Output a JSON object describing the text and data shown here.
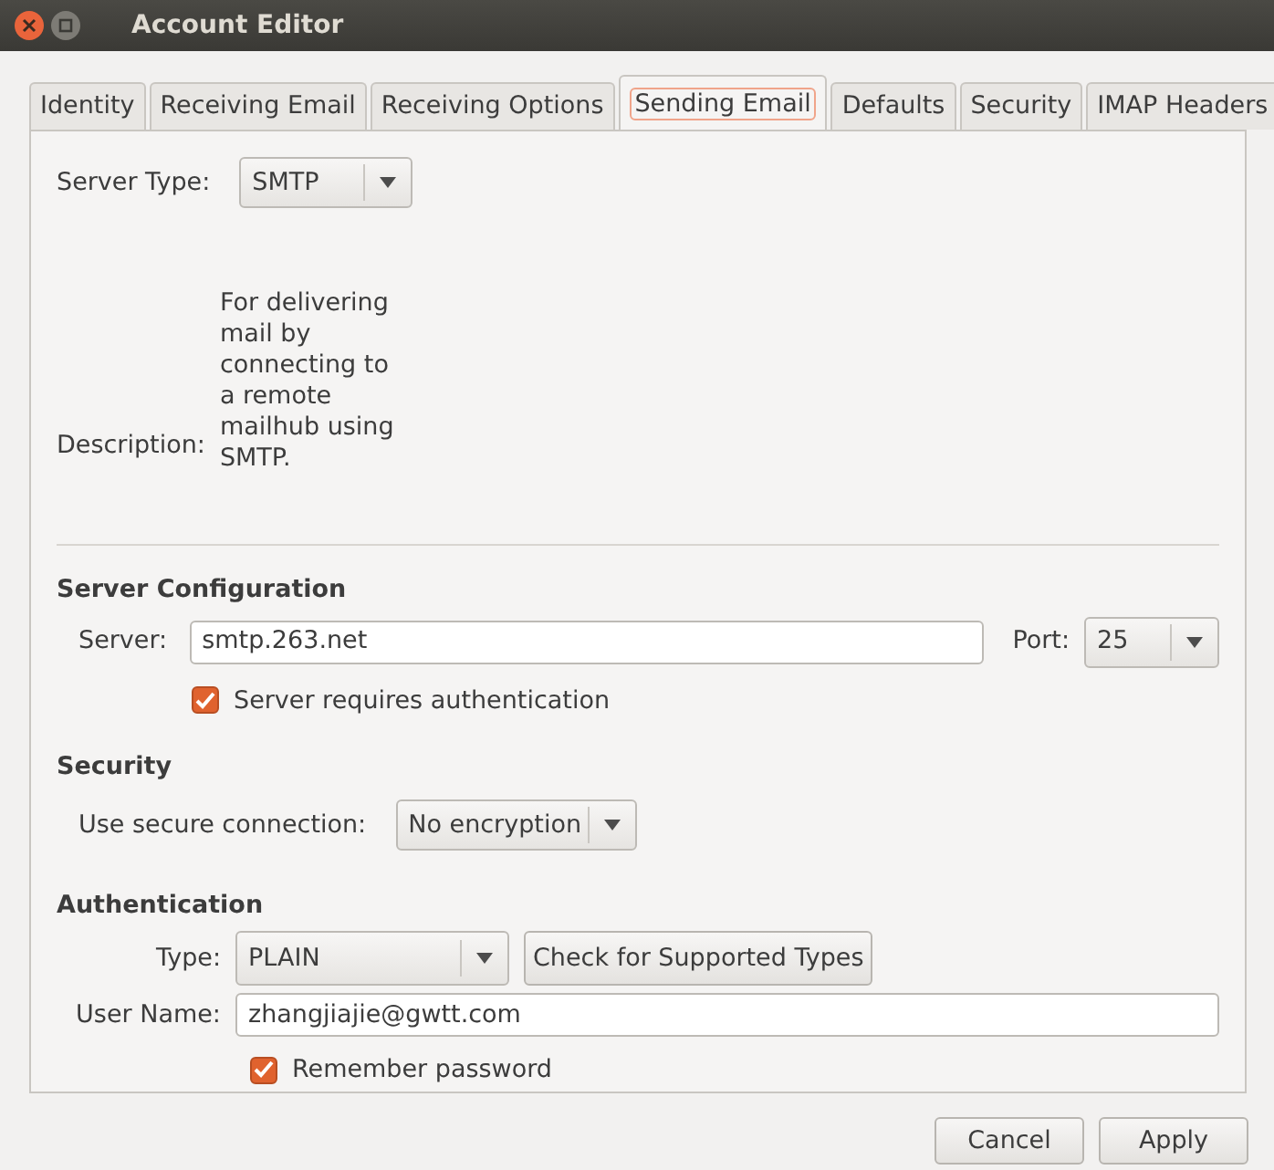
{
  "window": {
    "title": "Account Editor"
  },
  "tabs": [
    {
      "label": "Identity",
      "selected": false
    },
    {
      "label": "Receiving Email",
      "selected": false
    },
    {
      "label": "Receiving Options",
      "selected": false
    },
    {
      "label": "Sending Email",
      "selected": true
    },
    {
      "label": "Defaults",
      "selected": false
    },
    {
      "label": "Security",
      "selected": false
    },
    {
      "label": "IMAP Headers",
      "selected": false
    }
  ],
  "server_type": {
    "label": "Server Type:",
    "value": "SMTP"
  },
  "description": {
    "label": "Description:",
    "text": "For delivering mail by connecting to a remote mailhub using SMTP."
  },
  "server_configuration": {
    "heading": "Server Configuration",
    "server_label": "Server:",
    "server_value": "smtp.263.net",
    "port_label": "Port:",
    "port_value": "25",
    "auth_checkbox": {
      "label": "Server requires authentication",
      "checked": true
    }
  },
  "security": {
    "heading": "Security",
    "label": "Use secure connection:",
    "value": "No encryption"
  },
  "authentication": {
    "heading": "Authentication",
    "type_label": "Type:",
    "type_value": "PLAIN",
    "check_button": "Check for Supported Types",
    "username_label": "User Name:",
    "username_value": "zhangjiajie@gwtt.com",
    "remember_checkbox": {
      "label": "Remember password",
      "checked": true
    }
  },
  "buttons": [
    "Cancel",
    "Apply"
  ]
}
